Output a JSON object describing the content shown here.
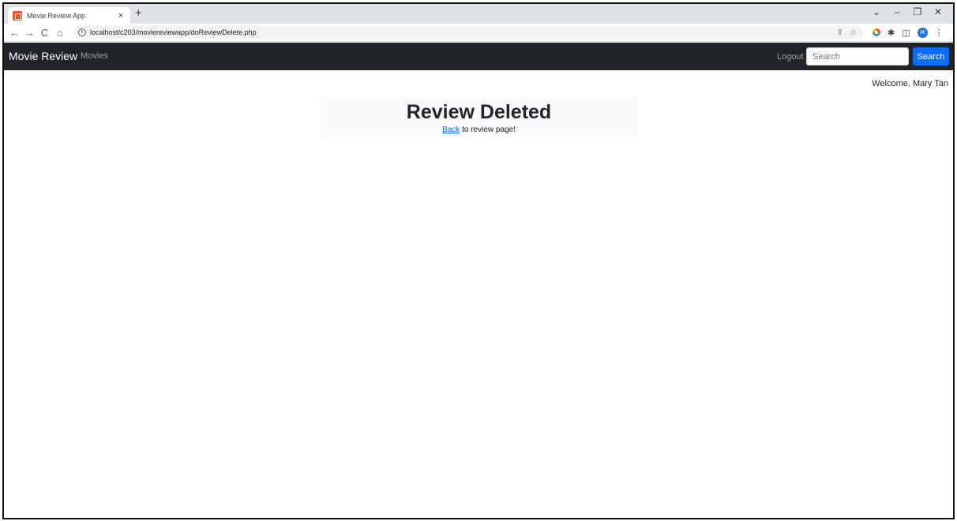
{
  "browser": {
    "tab_title": "Movie Review App",
    "tab_close": "×",
    "new_tab": "+",
    "url": "localhost/c203/moviereviewapp/doReviewDelete.php",
    "window_controls": [
      "⌄",
      "–",
      "❐",
      "✕"
    ],
    "profile_initial": "H"
  },
  "navbar": {
    "brand": "Movie Review",
    "movies_link": "Movies",
    "logout_link": "Logout",
    "search_placeholder": "Search",
    "search_button": "Search",
    "bg_color": "#212529",
    "button_color": "#0d6efd"
  },
  "main": {
    "welcome": "Welcome, Mary Tan",
    "heading": "Review Deleted",
    "back_link": "Back",
    "back_suffix": " to review page!"
  }
}
